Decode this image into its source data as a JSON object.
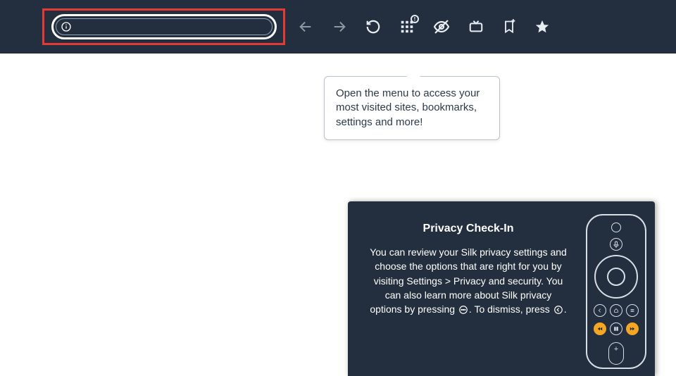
{
  "toolbar": {
    "url_value": "",
    "icons": {
      "info": "info-icon",
      "back": "back-arrow-icon",
      "forward": "forward-arrow-icon",
      "reload": "reload-icon",
      "menu": "apps-grid-icon",
      "menu_badge": "!",
      "private": "eye-off-icon",
      "tv": "tv-icon",
      "bookmark_add": "bookmark-add-icon",
      "star": "star-icon"
    }
  },
  "tooltip": {
    "text": "Open the menu to access your most visited sites, bookmarks, settings and more!"
  },
  "privacy": {
    "title": "Privacy Check-In",
    "body_pre": "You can review your Silk privacy settings and choose the options that are right for you by visiting Settings > Privacy and security. You can also learn more about Silk privacy options by pressing ",
    "body_mid": ". To dismiss, press ",
    "body_post": "."
  },
  "colors": {
    "toolbar_bg": "#232f3e",
    "highlight_border": "#e53935",
    "remote_accent": "#f5a623"
  }
}
